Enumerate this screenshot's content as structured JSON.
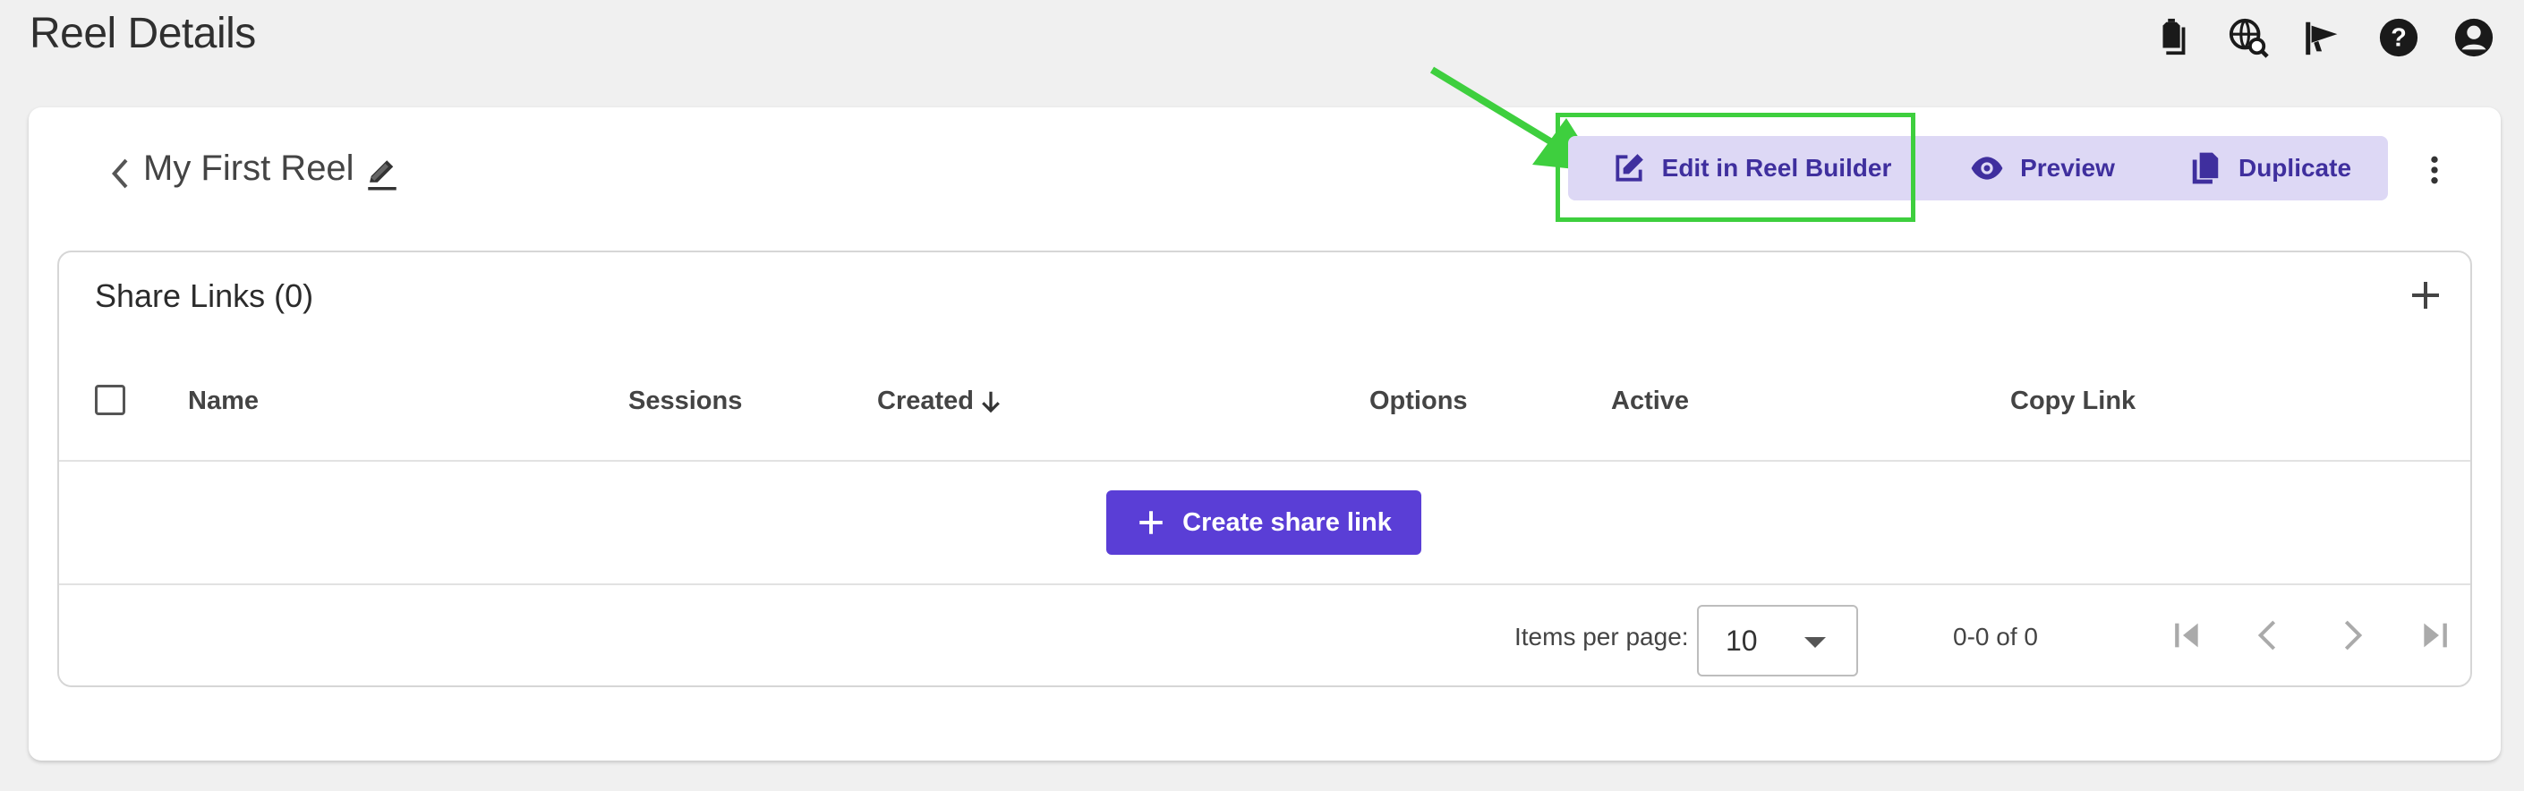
{
  "page": {
    "title": "Reel Details"
  },
  "top_icons": [
    "clipboard-icon",
    "globe-search-icon",
    "announcement-icon",
    "help-icon",
    "account-icon"
  ],
  "reel": {
    "name": "My First Reel"
  },
  "actions": {
    "edit_label": "Edit in Reel Builder",
    "preview_label": "Preview",
    "duplicate_label": "Duplicate"
  },
  "share_links": {
    "title": "Share Links (0)",
    "columns": {
      "name": "Name",
      "sessions": "Sessions",
      "created": "Created",
      "options": "Options",
      "active": "Active",
      "copy_link": "Copy Link"
    },
    "create_label": "Create share link"
  },
  "pagination": {
    "items_per_page_label": "Items per page:",
    "items_per_page_value": "10",
    "range": "0-0 of 0"
  },
  "colors": {
    "accent": "#5a3ed6",
    "button_bg": "#ddd8f5",
    "button_text": "#3f2f9e",
    "highlight": "#3ecf3e"
  }
}
